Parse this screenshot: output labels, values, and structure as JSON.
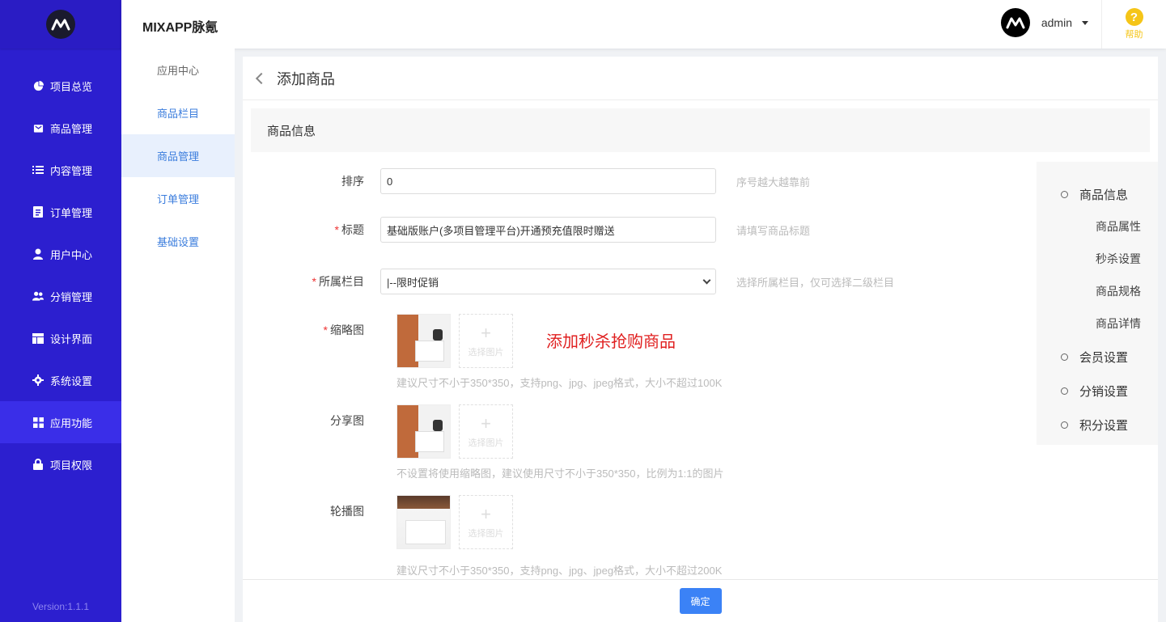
{
  "app": {
    "brand": "MIXAPP脉氪",
    "version": "Version:1.1.1"
  },
  "sidebar": {
    "items": [
      {
        "label": "项目总览",
        "icon": "pie-chart-icon"
      },
      {
        "label": "商品管理",
        "icon": "bag-icon"
      },
      {
        "label": "内容管理",
        "icon": "list-icon"
      },
      {
        "label": "订单管理",
        "icon": "document-icon"
      },
      {
        "label": "用户中心",
        "icon": "user-icon"
      },
      {
        "label": "分销管理",
        "icon": "users-icon"
      },
      {
        "label": "设计界面",
        "icon": "layout-icon"
      },
      {
        "label": "系统设置",
        "icon": "gear-icon"
      },
      {
        "label": "应用功能",
        "icon": "grid-icon",
        "active": true
      },
      {
        "label": "项目权限",
        "icon": "lock-icon"
      }
    ]
  },
  "header": {
    "username": "admin",
    "help_label": "帮助",
    "help_symbol": "?"
  },
  "subnav": {
    "items": [
      {
        "label": "应用中心"
      },
      {
        "label": "商品栏目"
      },
      {
        "label": "商品管理",
        "active": true
      },
      {
        "label": "订单管理"
      },
      {
        "label": "基础设置"
      }
    ]
  },
  "page": {
    "title": "添加商品",
    "section_title": "商品信息"
  },
  "form": {
    "sort": {
      "label": "排序",
      "value": "0",
      "hint": "序号越大越靠前"
    },
    "title": {
      "required_mark": "*",
      "label": "标题",
      "value": "基础版账户(多项目管理平台)开通预充值限时赠送",
      "hint": "请填写商品标题"
    },
    "category": {
      "required_mark": "*",
      "label": "所属栏目",
      "value": "|--限时促销",
      "hint": "选择所属栏目，仅可选择二级栏目"
    },
    "thumbnail": {
      "required_mark": "*",
      "label": "缩略图",
      "add_label": "选择图片",
      "hint": "建议尺寸不小于350*350，支持png、jpg、jpeg格式，大小不超过100K"
    },
    "share_image": {
      "label": "分享图",
      "add_label": "选择图片",
      "hint": "不设置将使用缩略图，建议使用尺寸不小于350*350，比例为1:1的图片"
    },
    "carousel": {
      "label": "轮播图",
      "add_label": "选择图片",
      "hint": "建议尺寸不小于350*350，支持png、jpg、jpeg格式，大小不超过200K"
    },
    "plus_symbol": "+"
  },
  "annotation": "添加秒杀抢购商品",
  "anchor_nav": {
    "items": [
      {
        "label": "商品信息",
        "level": 1
      },
      {
        "label": "商品属性",
        "level": 2
      },
      {
        "label": "秒杀设置",
        "level": 2
      },
      {
        "label": "商品规格",
        "level": 2
      },
      {
        "label": "商品详情",
        "level": 2
      },
      {
        "label": "会员设置",
        "level": 1
      },
      {
        "label": "分销设置",
        "level": 1
      },
      {
        "label": "积分设置",
        "level": 1
      }
    ]
  },
  "footer": {
    "submit_label": "确定"
  },
  "colors": {
    "sidebar_bg": "#2c1fcf",
    "sidebar_active": "#3a2ee8",
    "primary": "#3b82f6",
    "link": "#3b7ddd",
    "required": "#e33333",
    "help": "#f5c518"
  }
}
